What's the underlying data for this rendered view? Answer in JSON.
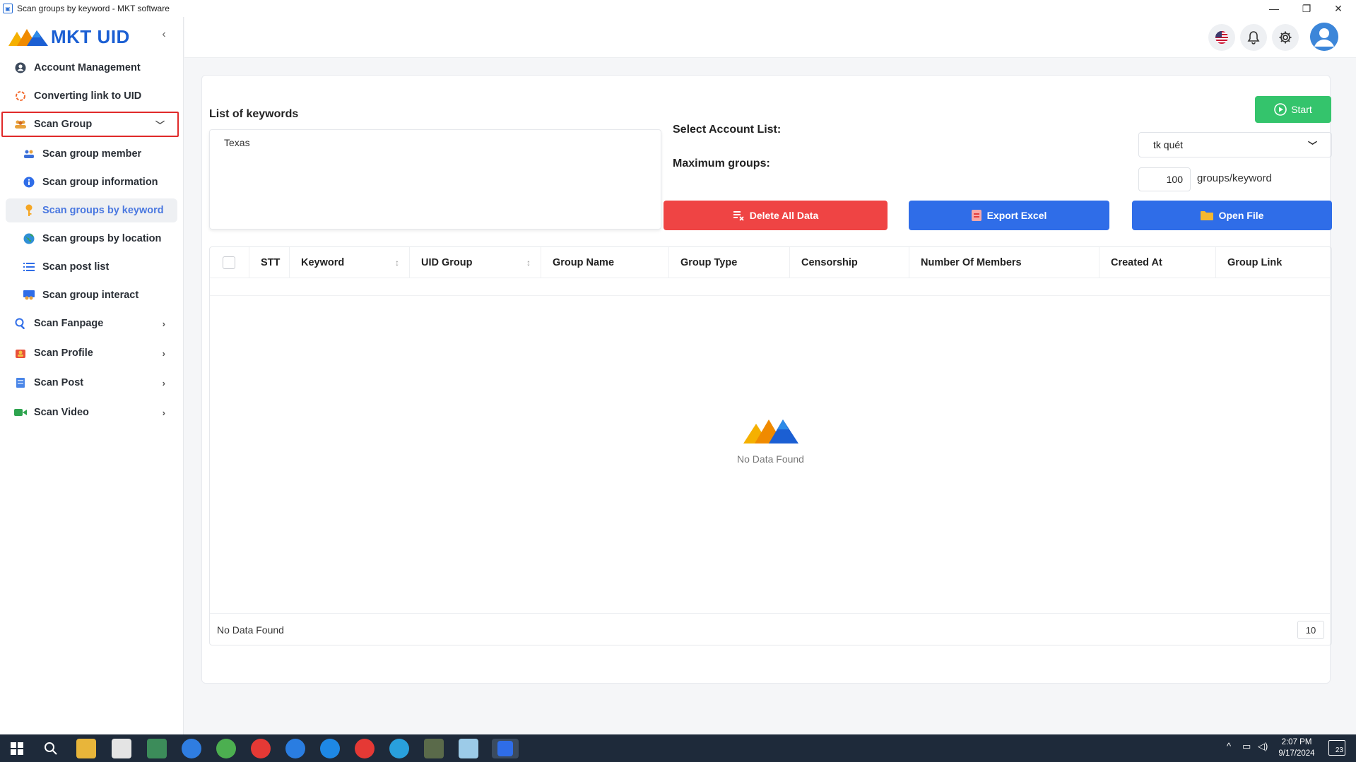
{
  "window": {
    "title": "Scan groups by keyword - MKT software"
  },
  "brand": {
    "name": "MKT UID",
    "accent": "#1b5fd3"
  },
  "sidebar": {
    "items": [
      {
        "label": "Account Management",
        "icon": "user-circle-icon"
      },
      {
        "label": "Converting link to UID",
        "icon": "refresh-icon"
      },
      {
        "label": "Scan Group",
        "icon": "group-icon"
      },
      {
        "label": "Scan Fanpage",
        "icon": "magnifier-icon"
      },
      {
        "label": "Scan Profile",
        "icon": "profile-icon"
      },
      {
        "label": "Scan Post",
        "icon": "post-icon"
      },
      {
        "label": "Scan Video",
        "icon": "video-camera-icon"
      }
    ],
    "subitems": [
      {
        "label": "Scan group member",
        "icon": "members-icon"
      },
      {
        "label": "Scan group information",
        "icon": "info-icon"
      },
      {
        "label": "Scan groups by keyword",
        "icon": "key-icon",
        "active": true
      },
      {
        "label": "Scan groups by location",
        "icon": "globe-icon"
      },
      {
        "label": "Scan post list",
        "icon": "list-icon"
      },
      {
        "label": "Scan group interact",
        "icon": "interact-icon"
      }
    ]
  },
  "form": {
    "keywords_title": "List of keywords",
    "keywords_value": "Texas",
    "start_label": "Start",
    "select_account_label": "Select Account List:",
    "account_value": "tk quét",
    "max_groups_label": "Maximum groups:",
    "max_groups_value": "100",
    "max_groups_unit": "groups/keyword",
    "delete_label": "Delete All Data",
    "export_label": "Export Excel",
    "open_label": "Open File",
    "colors": {
      "start": "#34c46c",
      "delete": "#ef4444",
      "export": "#2f6de8",
      "open": "#2f6de8"
    }
  },
  "table": {
    "columns": [
      "STT",
      "Keyword",
      "UID Group",
      "Group Name",
      "Group Type",
      "Censorship",
      "Number Of Members",
      "Created At",
      "Group Link"
    ],
    "empty_message": "No Data Found",
    "footer_text": "No Data Found",
    "page_size": "10"
  },
  "taskbar": {
    "time": "2:07 PM",
    "date": "9/17/2024",
    "notifications": "23"
  }
}
